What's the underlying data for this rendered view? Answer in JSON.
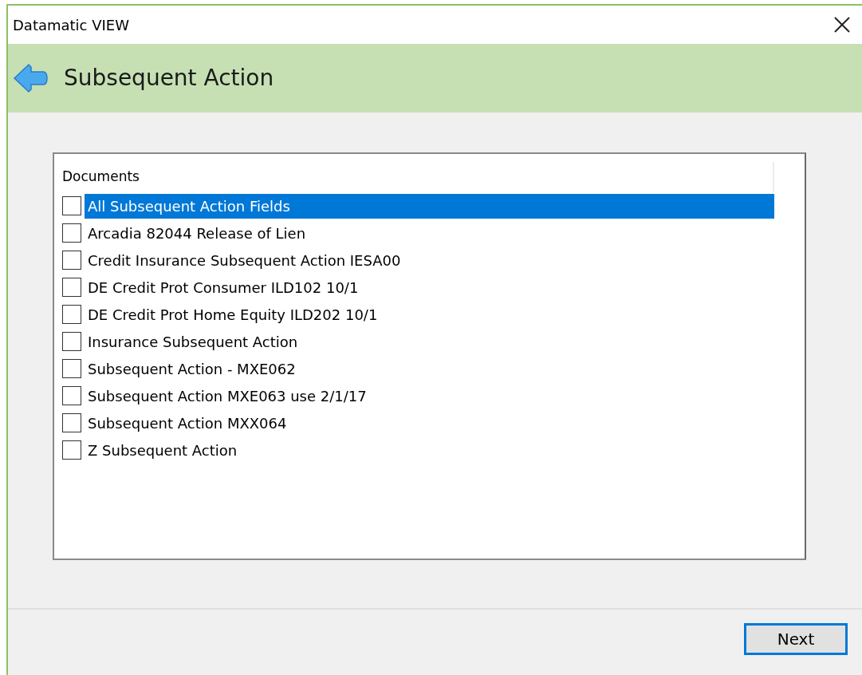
{
  "window": {
    "title": "Datamatic VIEW"
  },
  "header": {
    "title": "Subsequent Action"
  },
  "documents": {
    "heading": "Documents",
    "items": [
      {
        "label": "All Subsequent Action Fields",
        "checked": false,
        "selected": true
      },
      {
        "label": "Arcadia 82044 Release of Lien",
        "checked": false,
        "selected": false
      },
      {
        "label": "Credit Insurance Subsequent Action IESA00",
        "checked": false,
        "selected": false
      },
      {
        "label": "DE Credit Prot Consumer ILD102 10/1",
        "checked": false,
        "selected": false
      },
      {
        "label": "DE Credit Prot Home Equity ILD202 10/1",
        "checked": false,
        "selected": false
      },
      {
        "label": "Insurance Subsequent Action",
        "checked": false,
        "selected": false
      },
      {
        "label": "Subsequent Action - MXE062",
        "checked": false,
        "selected": false
      },
      {
        "label": "Subsequent Action MXE063 use 2/1/17",
        "checked": false,
        "selected": false
      },
      {
        "label": "Subsequent Action MXX064",
        "checked": false,
        "selected": false
      },
      {
        "label": "Z Subsequent Action",
        "checked": false,
        "selected": false
      }
    ]
  },
  "buttons": [
    {
      "label": "Next"
    }
  ]
}
